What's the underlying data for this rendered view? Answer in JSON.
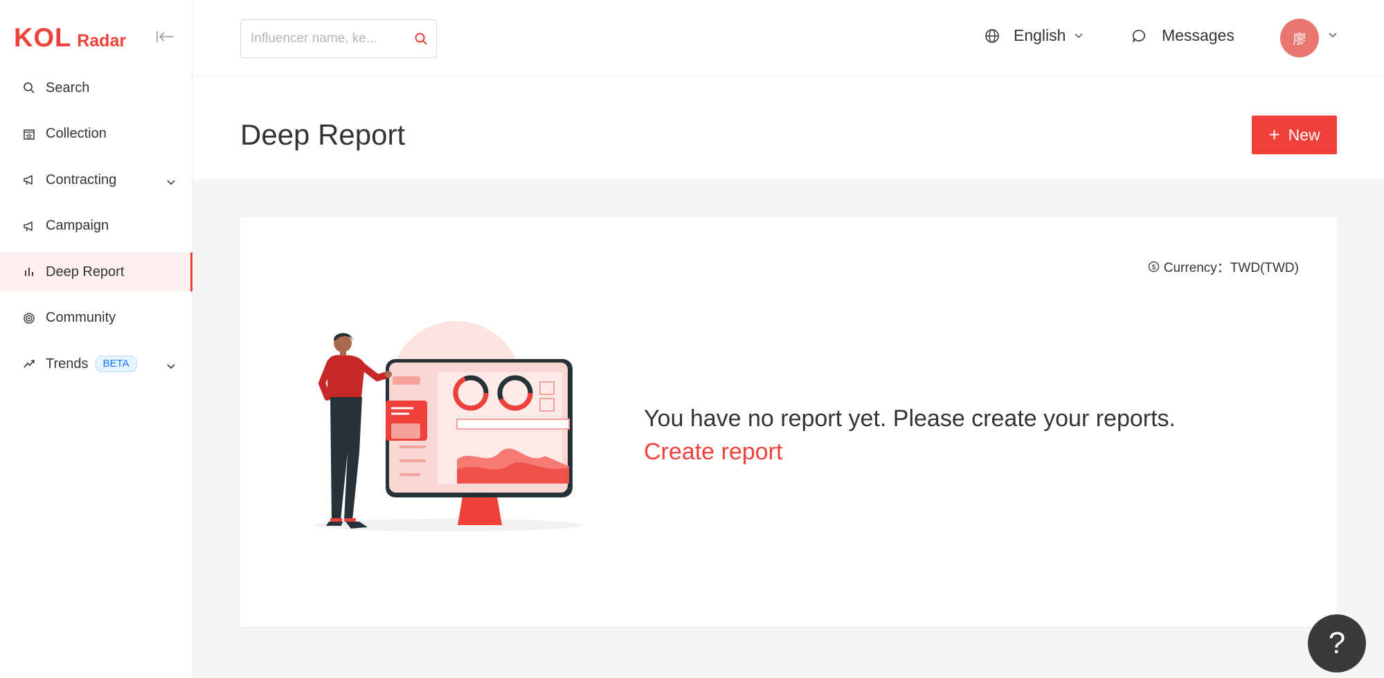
{
  "brand": {
    "name_part1": "KOL",
    "name_part2": "Radar",
    "color": "#f0403a"
  },
  "sidebar": {
    "items": [
      {
        "label": "Search",
        "icon": "search-icon"
      },
      {
        "label": "Collection",
        "icon": "collection-icon"
      },
      {
        "label": "Contracting",
        "icon": "megaphone-icon",
        "expandable": true
      },
      {
        "label": "Campaign",
        "icon": "megaphone-icon"
      },
      {
        "label": "Deep Report",
        "icon": "bar-chart-icon",
        "active": true
      },
      {
        "label": "Community",
        "icon": "target-icon"
      },
      {
        "label": "Trends",
        "icon": "trend-icon",
        "badge": "BETA",
        "expandable": true
      }
    ]
  },
  "topbar": {
    "search_placeholder": "Influencer name, ke...",
    "language": "English",
    "messages": "Messages",
    "avatar_text": "廖"
  },
  "header": {
    "title": "Deep Report",
    "new_label": "New"
  },
  "card": {
    "currency": "Currency：TWD(TWD)",
    "empty_message": "You have no report yet. Please create your reports.",
    "create_link": "Create report"
  },
  "help": {
    "label": "?"
  }
}
